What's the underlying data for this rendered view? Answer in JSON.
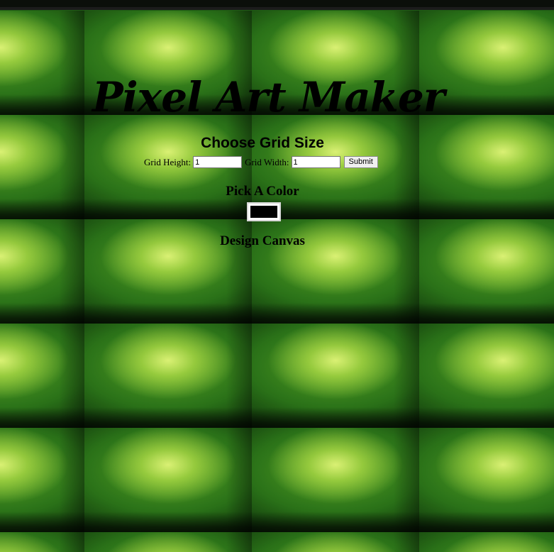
{
  "header": {
    "title": "Pixel Art Maker"
  },
  "grid_size": {
    "heading": "Choose Grid Size",
    "height_label": "Grid Height:",
    "height_value": "1",
    "width_label": "Grid Width:",
    "width_value": "1",
    "submit_label": "Submit"
  },
  "color": {
    "heading": "Pick A Color",
    "value": "#000000"
  },
  "canvas": {
    "heading": "Design Canvas"
  }
}
